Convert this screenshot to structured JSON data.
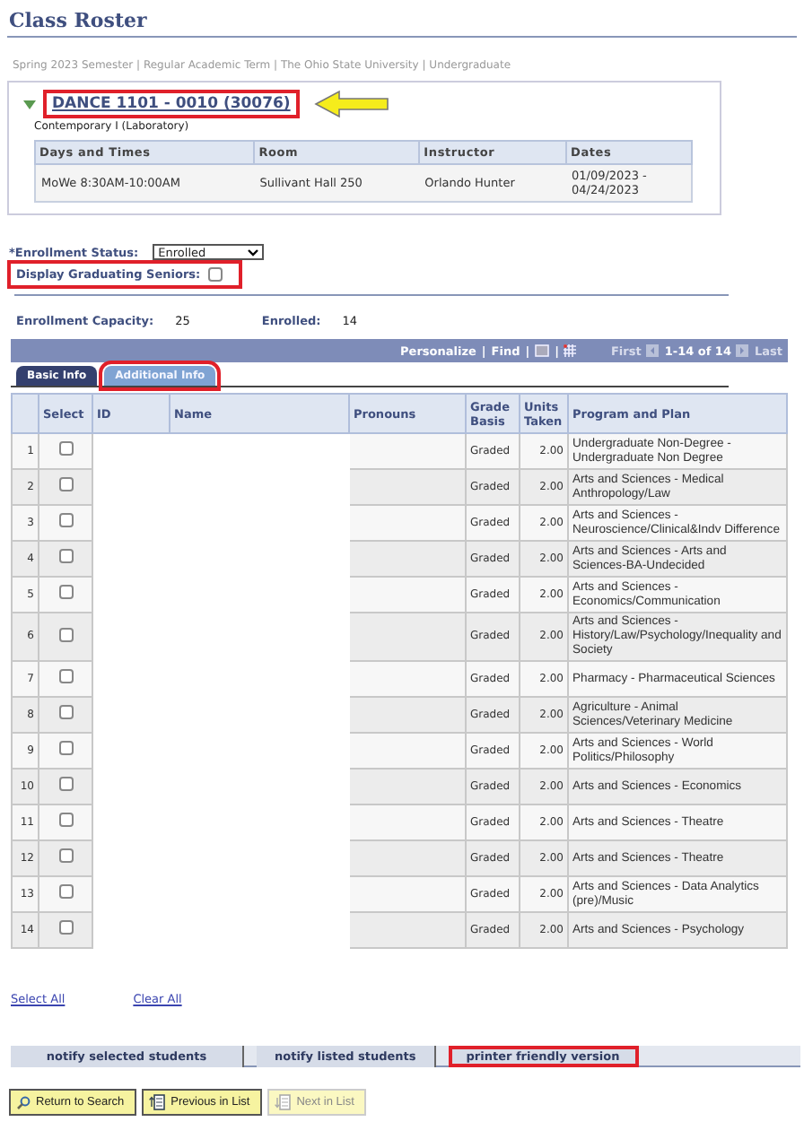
{
  "title": "Class Roster",
  "breadcrumb": "Spring 2023 Semester | Regular Academic Term | The Ohio State University | Undergraduate",
  "course": {
    "link": "DANCE 1101 - 0010 (30076)",
    "highlighted": true,
    "expanded": true,
    "description": "Contemporary I (Laboratory)",
    "meeting_columns": [
      "Days and Times",
      "Room",
      "Instructor",
      "Dates"
    ],
    "meeting": [
      "MoWe 8:30AM-10:00AM",
      "Sullivant Hall 250",
      "Orlando Hunter",
      "01/09/2023 - 04/24/2023"
    ]
  },
  "enrollment_status": {
    "label": "*Enrollment Status:",
    "value": "Enrolled"
  },
  "graduating_seniors": {
    "label": "Display Graduating Seniors:",
    "checked": false,
    "highlighted": true
  },
  "capacity": {
    "label": "Enrollment Capacity:",
    "value": "25"
  },
  "enrolled": {
    "label": "Enrolled:",
    "value": "14"
  },
  "grid_bar": {
    "personalize": "Personalize",
    "find": "Find",
    "separator": "|",
    "first": "First",
    "range": "1-14 of 14",
    "last": "Last"
  },
  "tabs": [
    {
      "label": "Basic Info",
      "selected": false,
      "highlighted": false
    },
    {
      "label": "Additional Info",
      "selected": true,
      "highlighted": true
    }
  ],
  "columns": [
    "Select",
    "ID",
    "Name",
    "Pronouns",
    "Grade Basis",
    "Units Taken",
    "Program and Plan"
  ],
  "rows": [
    {
      "num": "1",
      "checked": false,
      "grade": "Graded",
      "units": "2.00",
      "program": "Undergraduate Non-Degree - Undergraduate Non Degree"
    },
    {
      "num": "2",
      "checked": false,
      "grade": "Graded",
      "units": "2.00",
      "program": "Arts and Sciences - Medical Anthropology/Law"
    },
    {
      "num": "3",
      "checked": false,
      "grade": "Graded",
      "units": "2.00",
      "program": "Arts and Sciences - Neuroscience/Clinical&Indv Difference"
    },
    {
      "num": "4",
      "checked": false,
      "grade": "Graded",
      "units": "2.00",
      "program": "Arts and Sciences - Arts and Sciences-BA-Undecided"
    },
    {
      "num": "5",
      "checked": false,
      "grade": "Graded",
      "units": "2.00",
      "program": "Arts and Sciences - Economics/Communication"
    },
    {
      "num": "6",
      "checked": false,
      "grade": "Graded",
      "units": "2.00",
      "program": "Arts and Sciences - History/Law/Psychology/Inequality and Society"
    },
    {
      "num": "7",
      "checked": false,
      "grade": "Graded",
      "units": "2.00",
      "program": "Pharmacy - Pharmaceutical Sciences"
    },
    {
      "num": "8",
      "checked": false,
      "grade": "Graded",
      "units": "2.00",
      "program": "Agriculture - Animal Sciences/Veterinary Medicine"
    },
    {
      "num": "9",
      "checked": false,
      "grade": "Graded",
      "units": "2.00",
      "program": "Arts and Sciences - World Politics/Philosophy"
    },
    {
      "num": "10",
      "checked": false,
      "grade": "Graded",
      "units": "2.00",
      "program": "Arts and Sciences - Economics"
    },
    {
      "num": "11",
      "checked": false,
      "grade": "Graded",
      "units": "2.00",
      "program": "Arts and Sciences - Theatre"
    },
    {
      "num": "12",
      "checked": false,
      "grade": "Graded",
      "units": "2.00",
      "program": "Arts and Sciences - Theatre"
    },
    {
      "num": "13",
      "checked": false,
      "grade": "Graded",
      "units": "2.00",
      "program": "Arts and Sciences - Data Analytics (pre)/Music"
    },
    {
      "num": "14",
      "checked": false,
      "grade": "Graded",
      "units": "2.00",
      "program": "Arts and Sciences - Psychology"
    }
  ],
  "links": [
    "Select All",
    "Clear All"
  ],
  "actions": [
    {
      "label": "notify selected students",
      "highlighted": false
    },
    {
      "label": "notify listed students",
      "highlighted": false
    },
    {
      "label": "printer friendly version",
      "highlighted": true
    }
  ],
  "nav_buttons": [
    {
      "kind": "search",
      "label": "Return to Search",
      "disabled": false
    },
    {
      "kind": "previous",
      "label": "Previous in List",
      "disabled": false
    },
    {
      "kind": "next",
      "label": "Next in List",
      "disabled": true
    }
  ]
}
